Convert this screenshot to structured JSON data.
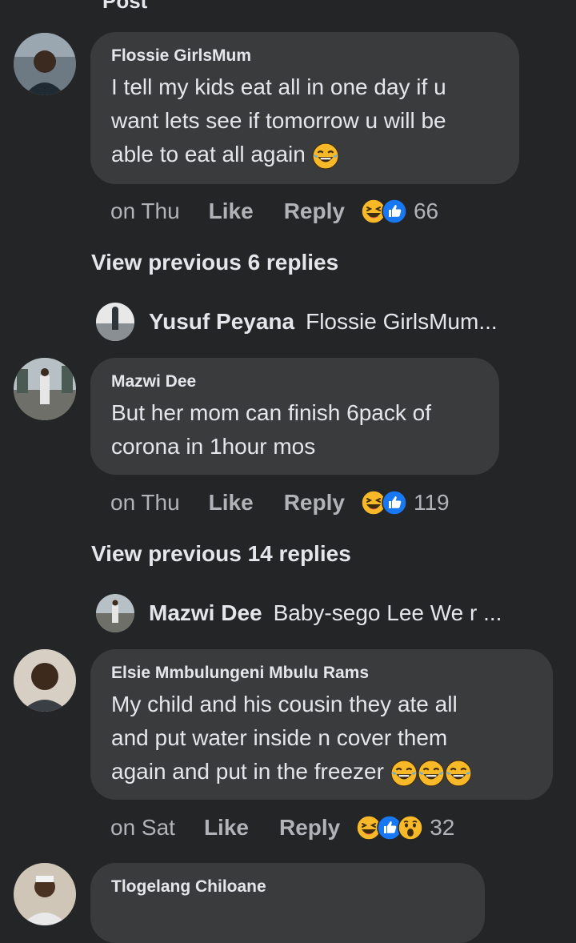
{
  "header": {
    "title": "Post"
  },
  "comments": [
    {
      "author": "Flossie GirlsMum",
      "lines": [
        "I tell my kids eat all in one day if u",
        "want lets see if tomorrow u will be",
        "able to eat all again"
      ],
      "time": "on Thu",
      "like": "Like",
      "reply": "Reply",
      "count": "66",
      "reactions": [
        "laugh-icon",
        "like-icon"
      ]
    },
    {
      "author": "Mazwi Dee",
      "lines": [
        "But her mom can finish 6pack of",
        "corona in 1hour mos"
      ],
      "time": "on Thu",
      "like": "Like",
      "reply": "Reply",
      "count": "119",
      "reactions": [
        "laugh-icon",
        "like-icon"
      ]
    },
    {
      "author": "Elsie Mmbulungeni Mbulu Rams",
      "lines": [
        "My child and his cousin they ate  all",
        "and put water inside n cover them",
        "again and put  in the freezer"
      ],
      "time": "on Sat",
      "like": "Like",
      "reply": "Reply",
      "count": "32",
      "reactions": [
        "laugh-icon",
        "like-icon",
        "wow-icon"
      ]
    },
    {
      "author": "Tlogelang Chiloane"
    }
  ],
  "view_previous": [
    "View previous 6 replies",
    "View previous 14 replies"
  ],
  "replies_preview": [
    {
      "name": "Yusuf Peyana",
      "text": "Flossie GirlsMum..."
    },
    {
      "name": "Mazwi Dee",
      "text": "Baby-sego Lee We r ..."
    }
  ],
  "colors": {
    "background": "#242526",
    "bubble": "#3a3b3c",
    "text": "#e4e6eb",
    "secondary": "#b0b3b8",
    "like_blue": "#1877f2",
    "emoji_yellow": "#f7b928"
  }
}
